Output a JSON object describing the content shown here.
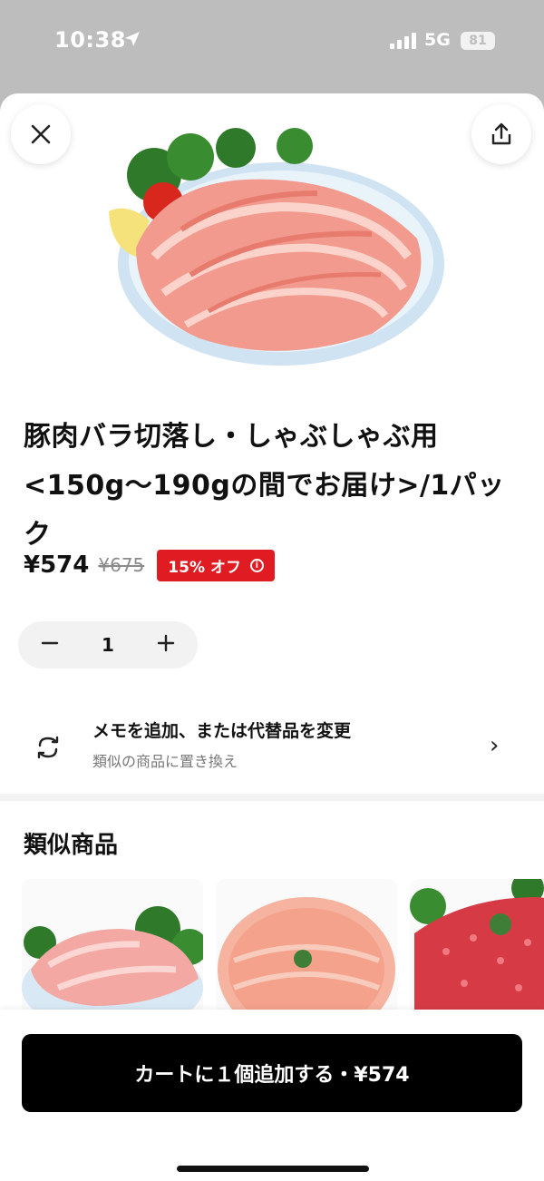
{
  "status_bar": {
    "time": "10:38",
    "network": "5G",
    "battery": "81",
    "icons": [
      "location-arrow-icon",
      "signal-bars-icon"
    ]
  },
  "header": {
    "close_icon": "close-icon",
    "share_icon": "share-icon"
  },
  "product": {
    "title": "豚肉バラ切落し・しゃぶしゃぶ用<150g〜190gの間でお届け>/1パック",
    "price": "¥574",
    "original_price": "¥675",
    "discount": "15% オフ",
    "discount_icon": "info-icon",
    "image": "sliced-pork-belly-plate"
  },
  "quantity": {
    "value": "1",
    "decrement_icon": "minus-icon",
    "increment_icon": "plus-icon"
  },
  "memo": {
    "title": "メモを追加、または代替品を変更",
    "subtitle": "類似の商品に置き換え",
    "icon": "swap-icon"
  },
  "similar": {
    "title": "類似商品",
    "items": [
      "pork-slices-image",
      "pork-shabu-platter-image",
      "ground-meat-image"
    ]
  },
  "footer": {
    "cart_button": "カートに１個追加する・¥574"
  },
  "colors": {
    "discount_badge": "#e11b22",
    "cart_button": "#000000",
    "status_bar_bg": "#bdbdbd"
  }
}
